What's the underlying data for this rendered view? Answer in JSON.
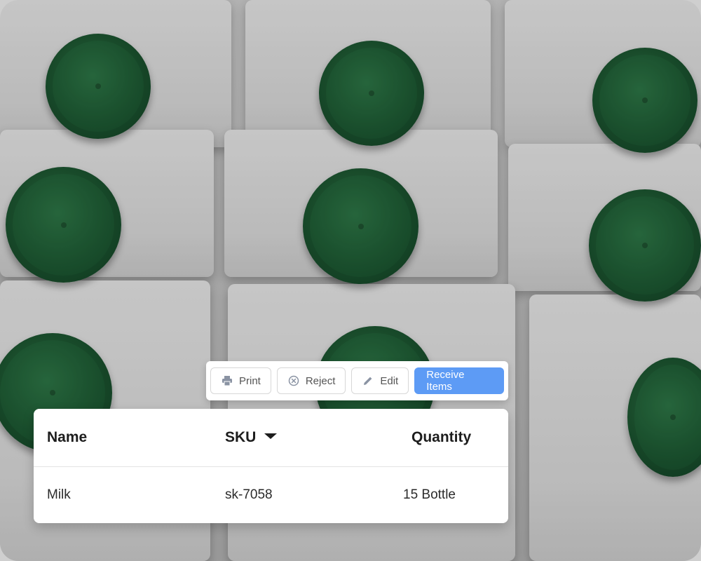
{
  "toolbar": {
    "print_label": "Print",
    "reject_label": "Reject",
    "edit_label": "Edit",
    "receive_label": "Receive Items",
    "print_icon": "printer-icon",
    "reject_icon": "circle-x-icon",
    "edit_icon": "pencil-icon",
    "primary_color": "#5d9bf5"
  },
  "table": {
    "columns": [
      "Name",
      "SKU",
      "Quantity"
    ],
    "sort_icon": "caret-down-icon",
    "rows": [
      {
        "name": "Milk",
        "sku": "sk-7058",
        "quantity": "15 Bottle"
      }
    ]
  }
}
